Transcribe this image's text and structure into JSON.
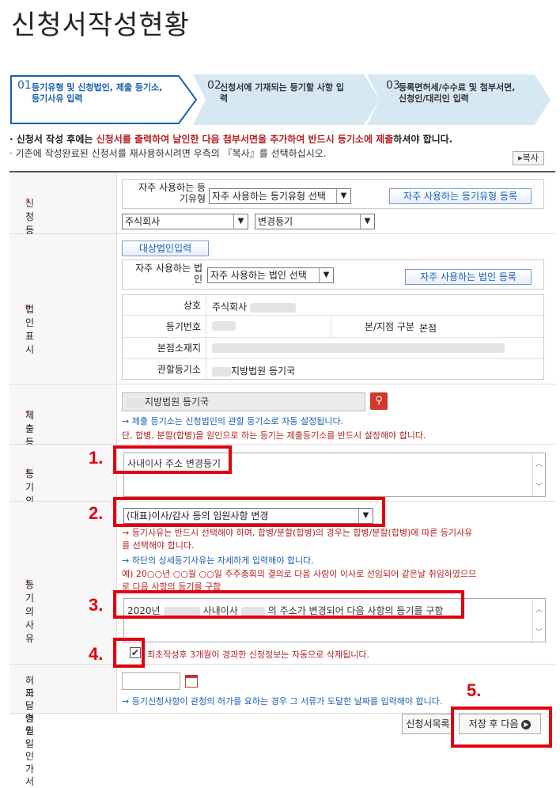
{
  "page_title": "신청서작성현황",
  "steps": [
    {
      "num": "01",
      "label_line1": "등기유형 및 신청법인, 제출 등기소,",
      "label_line2": "등기사유 입력"
    },
    {
      "num": "02",
      "label_line1": "신청서에 기재되는 등기할 사항 입",
      "label_line2": "력"
    },
    {
      "num": "03",
      "label_line1": "등록면허세/수수료 및 첨부서면,",
      "label_line2": "신청인/대리인 입력"
    }
  ],
  "notice": {
    "bullet": "·",
    "line1_a": "신청서 작성 후에는 ",
    "line1_b": "신청서를 출력하여 날인한 다음 첨부서면을 추가하여 반드시 등기소에 제출",
    "line1_c": "하셔야 합니다.",
    "line2": "기존에 작성완료된 신청서를 재사용하시려면 우측의 『복사』를 선택하십시오.",
    "copy_button": "복사"
  },
  "form": {
    "type": {
      "label": "신청등기유형",
      "fav_label": "자주 사용하는 등기유형",
      "fav_select": "자주 사용하는 등기유형 선택",
      "fav_register": "자주 사용하는 등기유형 등록",
      "company_type": "주식회사",
      "registration_type": "변경등기"
    },
    "corp": {
      "label": "법인표시",
      "target_button": "대상법인입력",
      "fav_label": "자주 사용하는 법인",
      "fav_select": "자주 사용하는 법인 선택",
      "fav_register": "자주 사용하는 법인 등록",
      "name_label": "상호",
      "name_value": "주식회사",
      "regno_label": "등기번호",
      "branch_label": "본/지점 구분",
      "branch_value": "본점",
      "hq_label": "본점소재지",
      "office_label": "관할등기소",
      "office_value": "지방법원 등기국"
    },
    "submit_office": {
      "label": "제출 등기소",
      "value": "지방법원  등기국",
      "note1": "→ 제출 등기소는 신청법인의 관할 등기소로 자동 설정됩니다.",
      "note2": "단, 합병, 분할(합병)을 원인으로 하는 등기는 제출등기소를 반드시 설정해야 합니다."
    },
    "purpose": {
      "label": "등기의목적",
      "value": "사내이사 주소 변경등기"
    },
    "reason": {
      "label": "등기의사유",
      "select": "(대표)이사/감사 등의 임원사항 변경",
      "note1": "→ 등기사유는 반드시 선택해야 하며, 합병/분할(합병)의 경우는 합병/분할(합병)에 따른 등기사유",
      "note1b": "를 선택해야 합니다.",
      "note2": "→ 하단의 상세등기사유는 자세하게 입력해야 합니다.",
      "example1": "예) 20○○년 ○○월 ○○일 주주총회의 결의로 다음 사람이 이사로 선임되어 같은날 취임하였으므",
      "example2": "로 다음 사항의 등기를 구함",
      "detail_a": "2020년",
      "detail_b": "사내이사",
      "detail_c": "의 주소가 변경되어 다음 사항의 등기를 구함",
      "auto_delete": "최초작성후 3개월이 경과한 신청정보는 자동으로 삭제됩니다."
    },
    "permit": {
      "label_line1": "허가·승인·인가서",
      "label_line2": "도달 연월일",
      "note": "→ 등기신청사항이 관청의 허가를 요하는 경우 그 서류가 도달한 날짜를 입력해야 합니다."
    }
  },
  "buttons": {
    "list": "신청서목록",
    "save_next": "저장 후 다음"
  },
  "markers": [
    "1.",
    "2.",
    "3.",
    "4.",
    "5."
  ],
  "colors": {
    "highlight": "#e00010",
    "step_active": "#1a5fb4",
    "warning_text": "#b22222"
  }
}
